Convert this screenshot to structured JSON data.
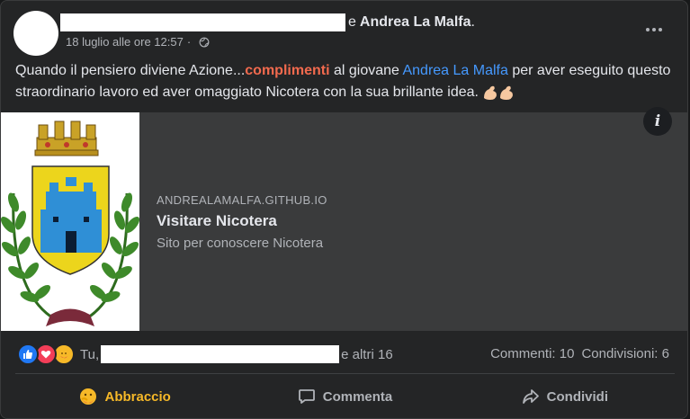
{
  "header": {
    "conjunction": "e",
    "author": "Andrea La Malfa",
    "trailing": ".",
    "timestamp": "18 luglio alle ore 12:57",
    "separator": "·",
    "privacy_icon": "globe-icon",
    "more_icon": "more-horizontal-icon"
  },
  "post": {
    "text_before": "Quando il pensiero diviene Azione...",
    "highlight": "complimenti",
    "text_mid": " al giovane ",
    "mention": "Andrea La Malfa",
    "text_after": "  per aver eseguito questo straordinario lavoro ed aver omaggiato Nicotera con la sua brillante idea.",
    "emoji": "flexed-biceps-emoji"
  },
  "link_preview": {
    "domain": "ANDREALAMALFA.GITHUB.IO",
    "title": "Visitare Nicotera",
    "description": "Sito per conoscere Nicotera",
    "info_icon": "i"
  },
  "reactions": {
    "icons": [
      "like-icon",
      "love-icon",
      "care-icon"
    ],
    "prefix": "Tu,",
    "suffix": "e altri 16",
    "comments": "Commenti: 10",
    "shares": "Condivisioni: 6"
  },
  "actions": {
    "react": "Abbraccio",
    "comment": "Commenta",
    "share": "Condividi"
  },
  "colors": {
    "background": "#242526",
    "highlight": "#f26a4e",
    "mention": "#4599ff",
    "care": "#f7b928"
  }
}
